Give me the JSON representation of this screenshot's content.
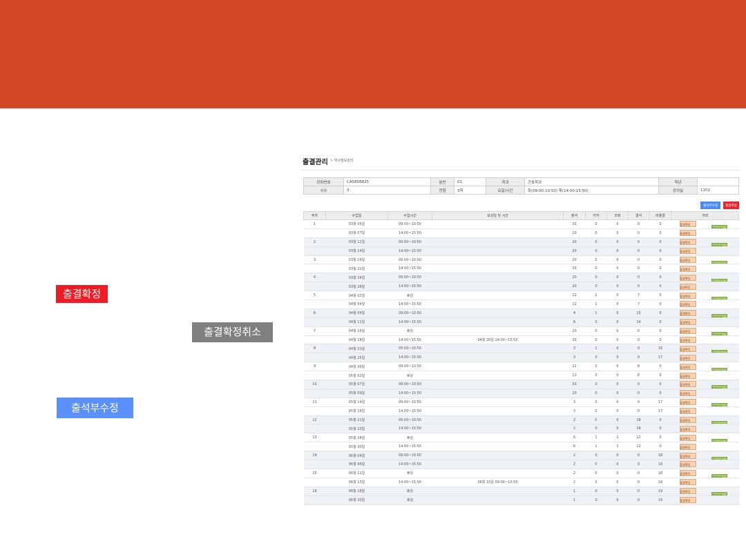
{
  "slide": {
    "tag_confirm": "출결확정",
    "tag_cancel": "출결확정취소",
    "tag_edit": "출석부수정"
  },
  "colors": {
    "banner": "#d24726",
    "confirm": "#ee1c24",
    "cancel": "#7f7f7f",
    "edit": "#5b8ff9"
  },
  "screen": {
    "title": "출결관리",
    "crumb": "> 학사정보관리"
  },
  "info": {
    "course_no_label": "강좌번호",
    "course_no": "CA5808825",
    "section_label": "분반",
    "section": "01",
    "dept_label": "학과",
    "dept": "간호학과",
    "grade_label": "학년",
    "grade": "",
    "time_label": "시수",
    "time": "3",
    "credit_label": "전형",
    "credit": "3학",
    "day_label": "요일/시간",
    "day": "화(09:00-10:50) 목(14:00-15:50)",
    "room_label": "강의실",
    "room": "1102"
  },
  "buttons": {
    "edit": "출석부수정",
    "confirm": "출결확정"
  },
  "grid": {
    "headers": [
      "주차",
      "수업일",
      "수업시간",
      "보강일 및 시간",
      "출석",
      "지각",
      "조퇴",
      "결석",
      "미출결",
      "처리"
    ],
    "confirm_label": "출결확정",
    "confirm_label_alt": "출결확정",
    "edit_label": "출결수정",
    "rows": [
      {
        "week": "1",
        "date": "03월 05일",
        "time": "09:00~10:50",
        "makeup": "",
        "att": "20",
        "late": "0",
        "early": "0",
        "abs": "0",
        "none": "0"
      },
      {
        "week": "",
        "date": "03월 07일",
        "time": "14:00~15:50",
        "makeup": "",
        "att": "20",
        "late": "0",
        "early": "0",
        "abs": "0",
        "none": "0"
      },
      {
        "week": "2",
        "date": "03월 12일",
        "time": "09:00~10:50",
        "makeup": "",
        "att": "20",
        "late": "0",
        "early": "0",
        "abs": "0",
        "none": "0"
      },
      {
        "week": "",
        "date": "03월 14일",
        "time": "14:00~15:50",
        "makeup": "",
        "att": "20",
        "late": "0",
        "early": "0",
        "abs": "0",
        "none": "0"
      },
      {
        "week": "3",
        "date": "03월 19일",
        "time": "09:00~10:50",
        "makeup": "",
        "att": "20",
        "late": "0",
        "early": "0",
        "abs": "0",
        "none": "0"
      },
      {
        "week": "",
        "date": "03월 21일",
        "time": "14:00~15:50",
        "makeup": "",
        "att": "20",
        "late": "0",
        "early": "0",
        "abs": "0",
        "none": "0"
      },
      {
        "week": "4",
        "date": "03월 26일",
        "time": "09:00~10:50",
        "makeup": "",
        "att": "20",
        "late": "0",
        "early": "0",
        "abs": "0",
        "none": "0"
      },
      {
        "week": "",
        "date": "03월 28일",
        "time": "14:00~15:50",
        "makeup": "",
        "att": "20",
        "late": "0",
        "early": "0",
        "abs": "0",
        "none": "0"
      },
      {
        "week": "5",
        "date": "04월 02일",
        "time": "휴강",
        "makeup": "",
        "att": "12",
        "late": "1",
        "early": "0",
        "abs": "7",
        "none": "0"
      },
      {
        "week": "",
        "date": "04월 04일",
        "time": "14:00~15:50",
        "makeup": "",
        "att": "12",
        "late": "1",
        "early": "0",
        "abs": "7",
        "none": "0"
      },
      {
        "week": "6",
        "date": "04월 09일",
        "time": "09:00~10:50",
        "makeup": "",
        "att": "4",
        "late": "1",
        "early": "0",
        "abs": "15",
        "none": "0"
      },
      {
        "week": "",
        "date": "04월 11일",
        "time": "14:00~15:50",
        "makeup": "",
        "att": "6",
        "late": "0",
        "early": "0",
        "abs": "14",
        "none": "0"
      },
      {
        "week": "7",
        "date": "04월 16일",
        "time": "휴강",
        "makeup": "",
        "att": "20",
        "late": "0",
        "early": "0",
        "abs": "0",
        "none": "0"
      },
      {
        "week": "",
        "date": "04월 18일",
        "time": "14:00~15:50",
        "makeup": "04월 20일 14:00~15:50",
        "att": "20",
        "late": "0",
        "early": "0",
        "abs": "0",
        "none": "0"
      },
      {
        "week": "8",
        "date": "04월 23일",
        "time": "09:00~10:50",
        "makeup": "",
        "att": "3",
        "late": "1",
        "early": "0",
        "abs": "0",
        "none": "16"
      },
      {
        "week": "",
        "date": "04월 25일",
        "time": "14:00~15:50",
        "makeup": "",
        "att": "3",
        "late": "0",
        "early": "0",
        "abs": "0",
        "none": "17"
      },
      {
        "week": "9",
        "date": "04월 30일",
        "time": "09:00~10:50",
        "makeup": "",
        "att": "12",
        "late": "0",
        "early": "0",
        "abs": "8",
        "none": "0"
      },
      {
        "week": "",
        "date": "05월 02일",
        "time": "휴강",
        "makeup": "",
        "att": "12",
        "late": "0",
        "early": "0",
        "abs": "8",
        "none": "0"
      },
      {
        "week": "10",
        "date": "05월 07일",
        "time": "09:00~10:50",
        "makeup": "",
        "att": "20",
        "late": "0",
        "early": "0",
        "abs": "0",
        "none": "0"
      },
      {
        "week": "",
        "date": "05월 09일",
        "time": "14:00~15:50",
        "makeup": "",
        "att": "20",
        "late": "0",
        "early": "0",
        "abs": "0",
        "none": "0"
      },
      {
        "week": "11",
        "date": "05월 14일",
        "time": "09:00~10:50",
        "makeup": "",
        "att": "3",
        "late": "0",
        "early": "0",
        "abs": "0",
        "none": "17"
      },
      {
        "week": "",
        "date": "05월 16일",
        "time": "14:00~15:50",
        "makeup": "",
        "att": "3",
        "late": "0",
        "early": "0",
        "abs": "0",
        "none": "17"
      },
      {
        "week": "12",
        "date": "05월 21일",
        "time": "09:00~10:50",
        "makeup": "",
        "att": "2",
        "late": "0",
        "early": "0",
        "abs": "18",
        "none": "0"
      },
      {
        "week": "",
        "date": "05월 23일",
        "time": "14:00~15:50",
        "makeup": "",
        "att": "2",
        "late": "0",
        "early": "0",
        "abs": "18",
        "none": "0"
      },
      {
        "week": "13",
        "date": "05월 28일",
        "time": "휴강",
        "makeup": "",
        "att": "6",
        "late": "1",
        "early": "1",
        "abs": "12",
        "none": "0"
      },
      {
        "week": "",
        "date": "05월 30일",
        "time": "14:00~15:50",
        "makeup": "",
        "att": "6",
        "late": "1",
        "early": "1",
        "abs": "12",
        "none": "0"
      },
      {
        "week": "14",
        "date": "06월 04일",
        "time": "09:00~10:50",
        "makeup": "",
        "att": "2",
        "late": "0",
        "early": "0",
        "abs": "0",
        "none": "18"
      },
      {
        "week": "",
        "date": "06월 06일",
        "time": "14:00~15:50",
        "makeup": "",
        "att": "2",
        "late": "0",
        "early": "0",
        "abs": "0",
        "none": "18"
      },
      {
        "week": "15",
        "date": "06월 11일",
        "time": "휴강",
        "makeup": "",
        "att": "2",
        "late": "0",
        "early": "0",
        "abs": "0",
        "none": "18"
      },
      {
        "week": "",
        "date": "06월 13일",
        "time": "14:00~15:50",
        "makeup": "06월 15일 09:00~10:50",
        "att": "2",
        "late": "0",
        "early": "0",
        "abs": "0",
        "none": "18"
      },
      {
        "week": "16",
        "date": "06월 18일",
        "time": "휴강",
        "makeup": "",
        "att": "1",
        "late": "0",
        "early": "0",
        "abs": "0",
        "none": "19"
      },
      {
        "week": "",
        "date": "06월 20일",
        "time": "휴강",
        "makeup": "",
        "att": "1",
        "late": "0",
        "early": "0",
        "abs": "0",
        "none": "19"
      }
    ]
  }
}
